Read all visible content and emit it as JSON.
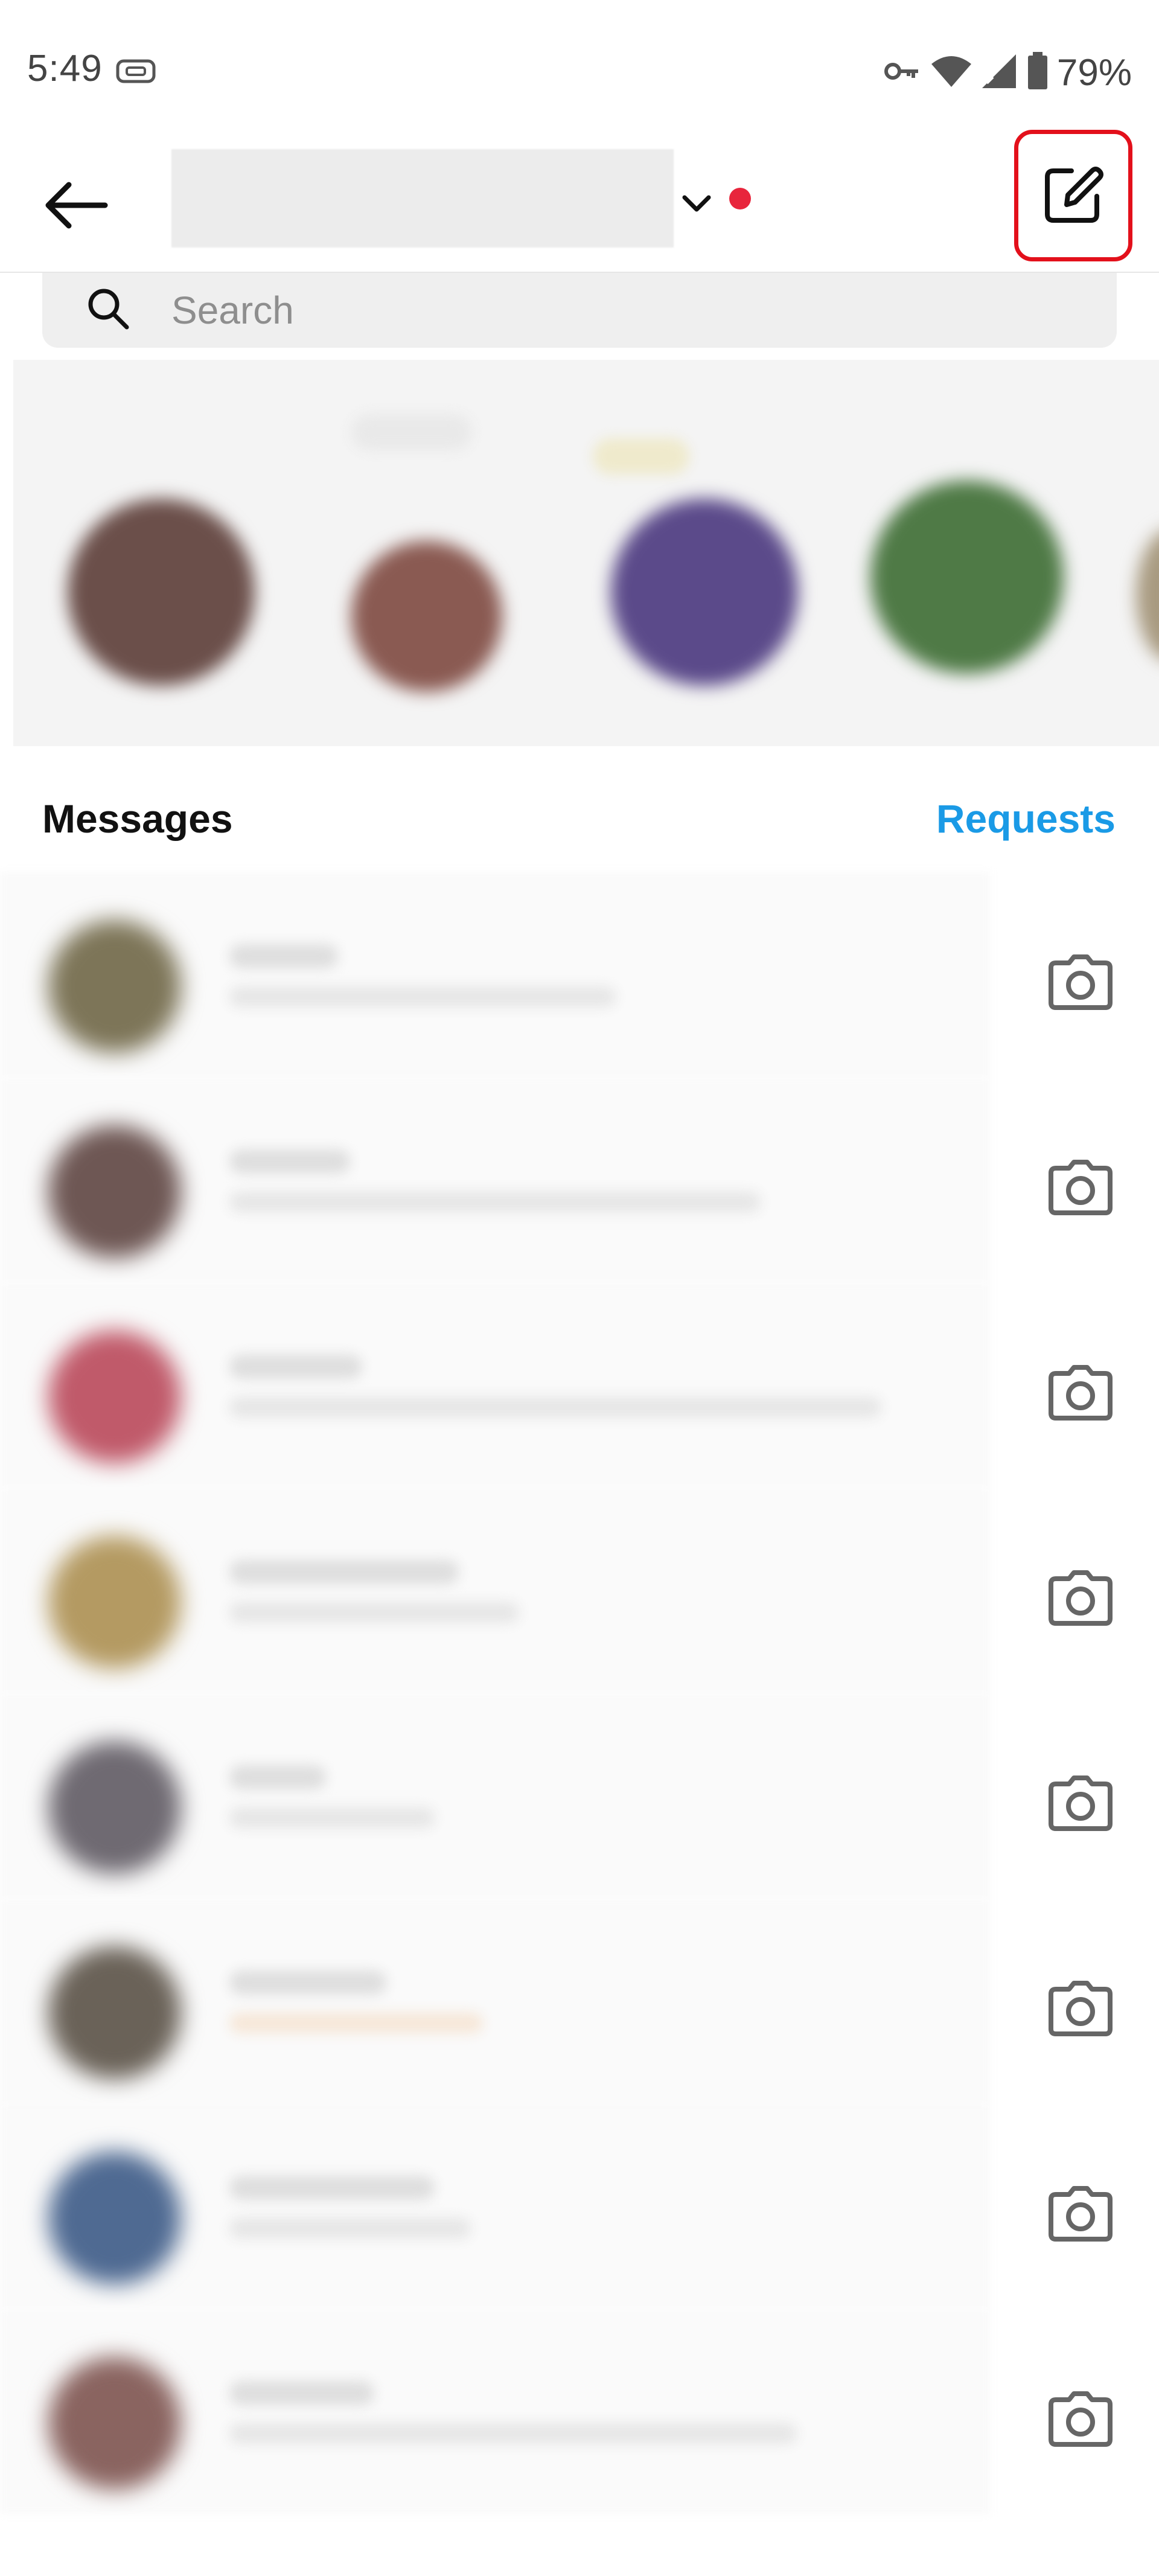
{
  "status_bar": {
    "time": "5:49",
    "battery_percent": "79%",
    "icons": [
      "vpn-icon",
      "key-icon",
      "wifi-icon",
      "cellular-signal-icon",
      "battery-icon"
    ]
  },
  "header": {
    "back_icon": "arrow-left-icon",
    "account_name": "",
    "dropdown_icon": "chevron-down-icon",
    "compose_icon": "new-message-icon",
    "highlight_color": "#e3101b",
    "notification_dot_color": "#e8253c"
  },
  "search": {
    "placeholder": "Search",
    "value": "",
    "icon": "search-icon"
  },
  "notes": {
    "items": [
      {
        "avatar_color": "#6b4f4a"
      },
      {
        "avatar_color": "#8a5a52"
      },
      {
        "avatar_color": "#5b4a8a"
      },
      {
        "avatar_color": "#4f7a46"
      },
      {
        "avatar_color": "#a89a80"
      }
    ]
  },
  "messages_section": {
    "title": "Messages",
    "requests_label": "Requests",
    "requests_color": "#1a9ae6"
  },
  "messages": {
    "rows": [
      {
        "avatar_color": "#7d7558",
        "action_icon": "camera-icon"
      },
      {
        "avatar_color": "#6e5754",
        "action_icon": "camera-icon"
      },
      {
        "avatar_color": "#c05a6a",
        "action_icon": "camera-icon"
      },
      {
        "avatar_color": "#b49a62",
        "action_icon": "camera-icon"
      },
      {
        "avatar_color": "#6f6a72",
        "action_icon": "camera-icon"
      },
      {
        "avatar_color": "#6a6258",
        "action_icon": "camera-icon"
      },
      {
        "avatar_color": "#4f6a92",
        "action_icon": "camera-icon"
      },
      {
        "avatar_color": "#8a6460",
        "action_icon": "camera-icon"
      }
    ]
  }
}
